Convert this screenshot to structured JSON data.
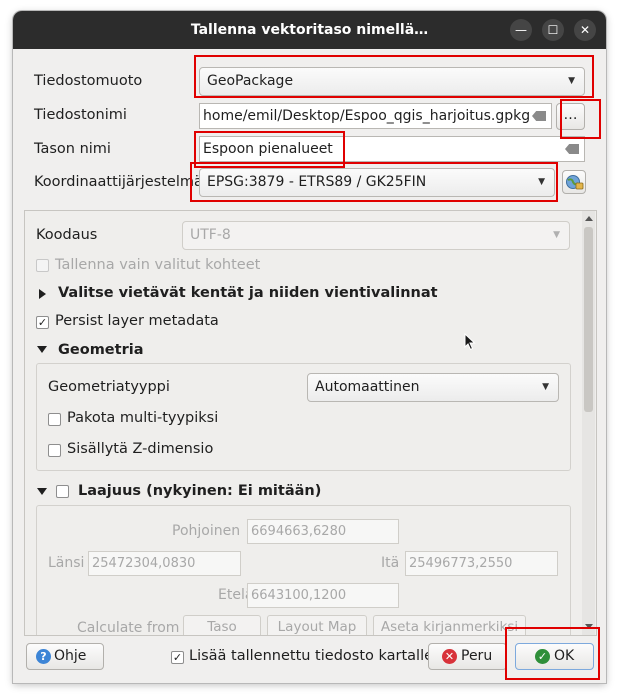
{
  "window": {
    "title": "Tallenna vektoritaso nimellä…",
    "minimize_glyph": "—",
    "maximize_glyph": "☐",
    "close_glyph": "✕"
  },
  "form": {
    "format_label": "Tiedostomuoto",
    "format_value": "GeoPackage",
    "filename_label": "Tiedostonimi",
    "filename_value": "home/emil/Desktop/Espoo_qgis_harjoitus.gpkg",
    "browse_label": "…",
    "layername_label": "Tason nimi",
    "layername_value": "Espoon pienalueet",
    "crs_label": "Koordinaattijärjestelmä",
    "crs_value": "EPSG:3879 - ETRS89 / GK25FIN"
  },
  "options": {
    "encoding_label": "Koodaus",
    "encoding_value": "UTF-8",
    "selected_only_label": "Tallenna vain valitut kohteet",
    "fields_section_label": "Valitse vietävät kentät ja niiden vientivalinnat",
    "persist_metadata_label": "Persist layer metadata",
    "geometry_section_label": "Geometria",
    "geometry_type_label": "Geometriatyyppi",
    "geometry_type_value": "Automaattinen",
    "force_multi_label": "Pakota multi-tyypiksi",
    "include_z_label": "Sisällytä Z-dimensio",
    "extent_section_label": "Laajuus (nykyinen: Ei mitään)",
    "north_label": "Pohjoinen",
    "north_value": "6694663,6280",
    "west_label": "Länsi",
    "west_value": "25472304,0830",
    "east_label": "Itä",
    "east_value": "25496773,2550",
    "south_label": "Etelä",
    "south_value": "6643100,1200",
    "calculate_from_label": "Calculate from",
    "calc_layer_label": "Taso",
    "calc_layout_label": "Layout Map",
    "calc_bookmark_label": "Aseta kirjanmerkiksi"
  },
  "footer": {
    "help_label": "Ohje",
    "add_to_map_label": "Lisää tallennettu tiedosto kartalle",
    "cancel_label": "Peru",
    "ok_label": "OK"
  },
  "colors": {
    "highlight": "#e00000",
    "titlebar": "#2c2c2c",
    "accent_blue": "#3d85d6"
  },
  "icons": [
    "help-icon",
    "cancel-icon",
    "ok-icon",
    "crs-select-icon",
    "clear-icon",
    "mouse-cursor-icon"
  ]
}
